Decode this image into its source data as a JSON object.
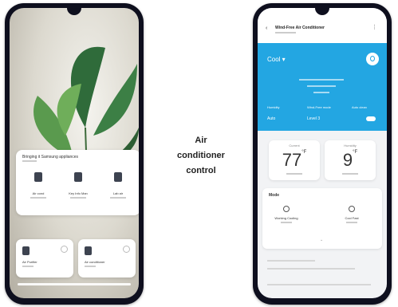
{
  "caption": {
    "line1": "Air",
    "line2": "conditioner",
    "line3": "control"
  },
  "left_phone": {
    "room_title": "Bringing it Samsung appliances",
    "devices": [
      {
        "label": "Air cond",
        "icon": "air-conditioner-icon"
      },
      {
        "label": "Key Info Man",
        "icon": "washer-icon"
      },
      {
        "label": "Lab air",
        "icon": "refrigerator-icon"
      }
    ],
    "tiles": [
      {
        "label": "Air Purifier",
        "icon": "air-purifier-icon"
      },
      {
        "label": "Air conditioner",
        "icon": "air-conditioner-icon"
      }
    ]
  },
  "right_phone": {
    "header_title": "Wind-Free Air Conditioner",
    "mode_label": "Cool",
    "blue_labels": [
      "Humidity",
      "Wind-Free mode",
      "Auto clean"
    ],
    "blue_values": [
      "Auto",
      "Level 3"
    ],
    "current_temp": "77",
    "current_caption": "Current",
    "humidity_value": "9",
    "humidity_caption": "Humidity",
    "temp_unit": "°F",
    "mode_section_title": "Mode",
    "mode_options": [
      {
        "label": "Working Cooling",
        "icon": "snowflake-icon"
      },
      {
        "label": "Cool Fast",
        "icon": "fan-icon"
      }
    ],
    "accent_color": "#23a6e2"
  }
}
